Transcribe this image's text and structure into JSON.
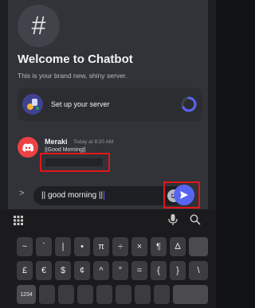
{
  "welcome": {
    "channel_glyph": "#",
    "title": "Welcome to Chatbot",
    "subtitle": "This is your brand new, shiny server."
  },
  "setup_card": {
    "label": "Set up your server",
    "icon": "server-setup-illustration",
    "progress_icon": "progress-ring-icon"
  },
  "message": {
    "author": "Meraki",
    "timestamp": "Today at 8:20 AM",
    "text": "||Good Morning||",
    "avatar_icon": "discord-logo-icon"
  },
  "composer": {
    "expand_glyph": ">",
    "input_value": "|| good morning ||",
    "emoji_icon": "emoji-icon",
    "send_icon": "send-arrow-icon"
  },
  "keyboard": {
    "toolbar": {
      "grid_icon": "apps-grid-icon",
      "mic_icon": "mic-icon",
      "search_icon": "search-icon"
    },
    "row1": [
      "~",
      "`",
      "|",
      "•",
      "π",
      "÷",
      "×",
      "¶",
      "Δ"
    ],
    "row2": [
      "£",
      "€",
      "$",
      "¢",
      "^",
      "°",
      "=",
      "{",
      "}",
      "\\"
    ],
    "row3_left": "1234"
  },
  "colors": {
    "accent": "#5865f2",
    "highlight": "#e3161b",
    "avatar": "#ed4245"
  }
}
